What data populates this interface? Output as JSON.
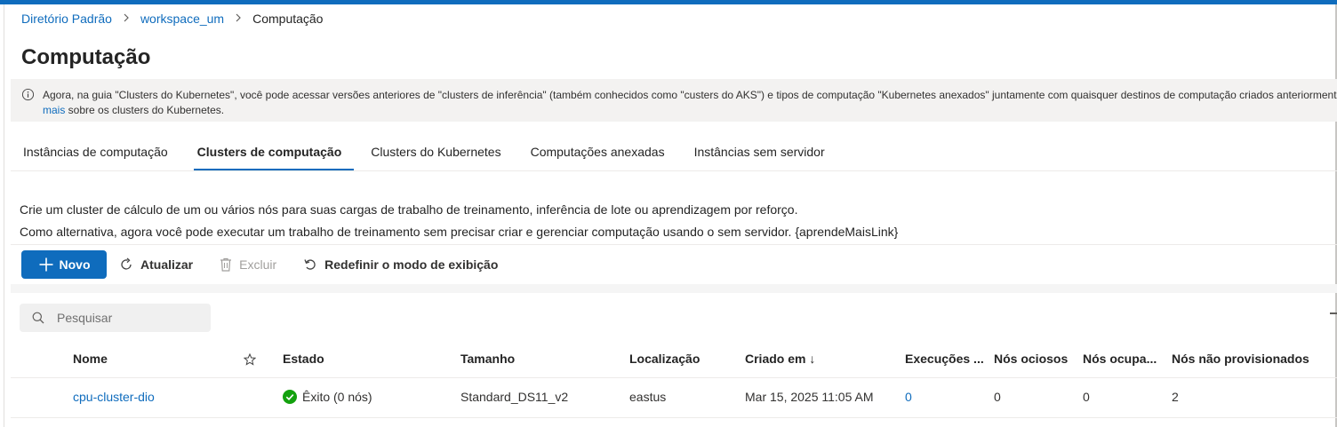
{
  "breadcrumb": {
    "items": [
      "Diretório Padrão",
      "workspace_um"
    ],
    "current": "Computação"
  },
  "page": {
    "title": "Computação"
  },
  "info": {
    "text": "Agora, na guia \"Clusters do Kubernetes\", você pode acessar versões anteriores de \"clusters de inferência\" (também conhecidos como \"custers do AKS\") e tipos de computação \"Kubernetes anexados\" juntamente com quaisquer destinos de computação criados anteriormente u",
    "link": "mais",
    "text_end": " sobre os clusters do Kubernetes."
  },
  "tabs": [
    {
      "label": "Instâncias de computação"
    },
    {
      "label": "Clusters de computação",
      "active": true
    },
    {
      "label": "Clusters do Kubernetes"
    },
    {
      "label": "Computações anexadas"
    },
    {
      "label": "Instâncias sem servidor"
    }
  ],
  "description": {
    "line1": "Crie um cluster de cálculo de um ou vários nós para suas cargas de trabalho de treinamento, inferência de lote ou aprendizagem por reforço.",
    "line2": "Como alternativa, agora você pode executar um trabalho de treinamento sem precisar criar e gerenciar computação usando o sem servidor. {aprendeMaisLink}"
  },
  "toolbar": {
    "new_label": "Novo",
    "refresh_label": "Atualizar",
    "delete_label": "Excluir",
    "reset_label": "Redefinir o modo de exibição"
  },
  "search": {
    "placeholder": "Pesquisar"
  },
  "table": {
    "columns": {
      "name": "Nome",
      "state": "Estado",
      "size": "Tamanho",
      "location": "Localização",
      "created": "Criado em ↓",
      "runs": "Execuções ...",
      "idle": "Nós ociosos",
      "busy": "Nós ocupa...",
      "unprov": "Nós não provisionados"
    },
    "rows": [
      {
        "name": "cpu-cluster-dio",
        "state": "Êxito (0 nós)",
        "size": "Standard_DS11_v2",
        "location": "eastus",
        "created": "Mar 15, 2025 11:05 AM",
        "runs": "0",
        "idle": "0",
        "busy": "0",
        "unprov": "2"
      }
    ]
  },
  "colors": {
    "accent": "#0f6cbd",
    "success": "#13a10e"
  }
}
